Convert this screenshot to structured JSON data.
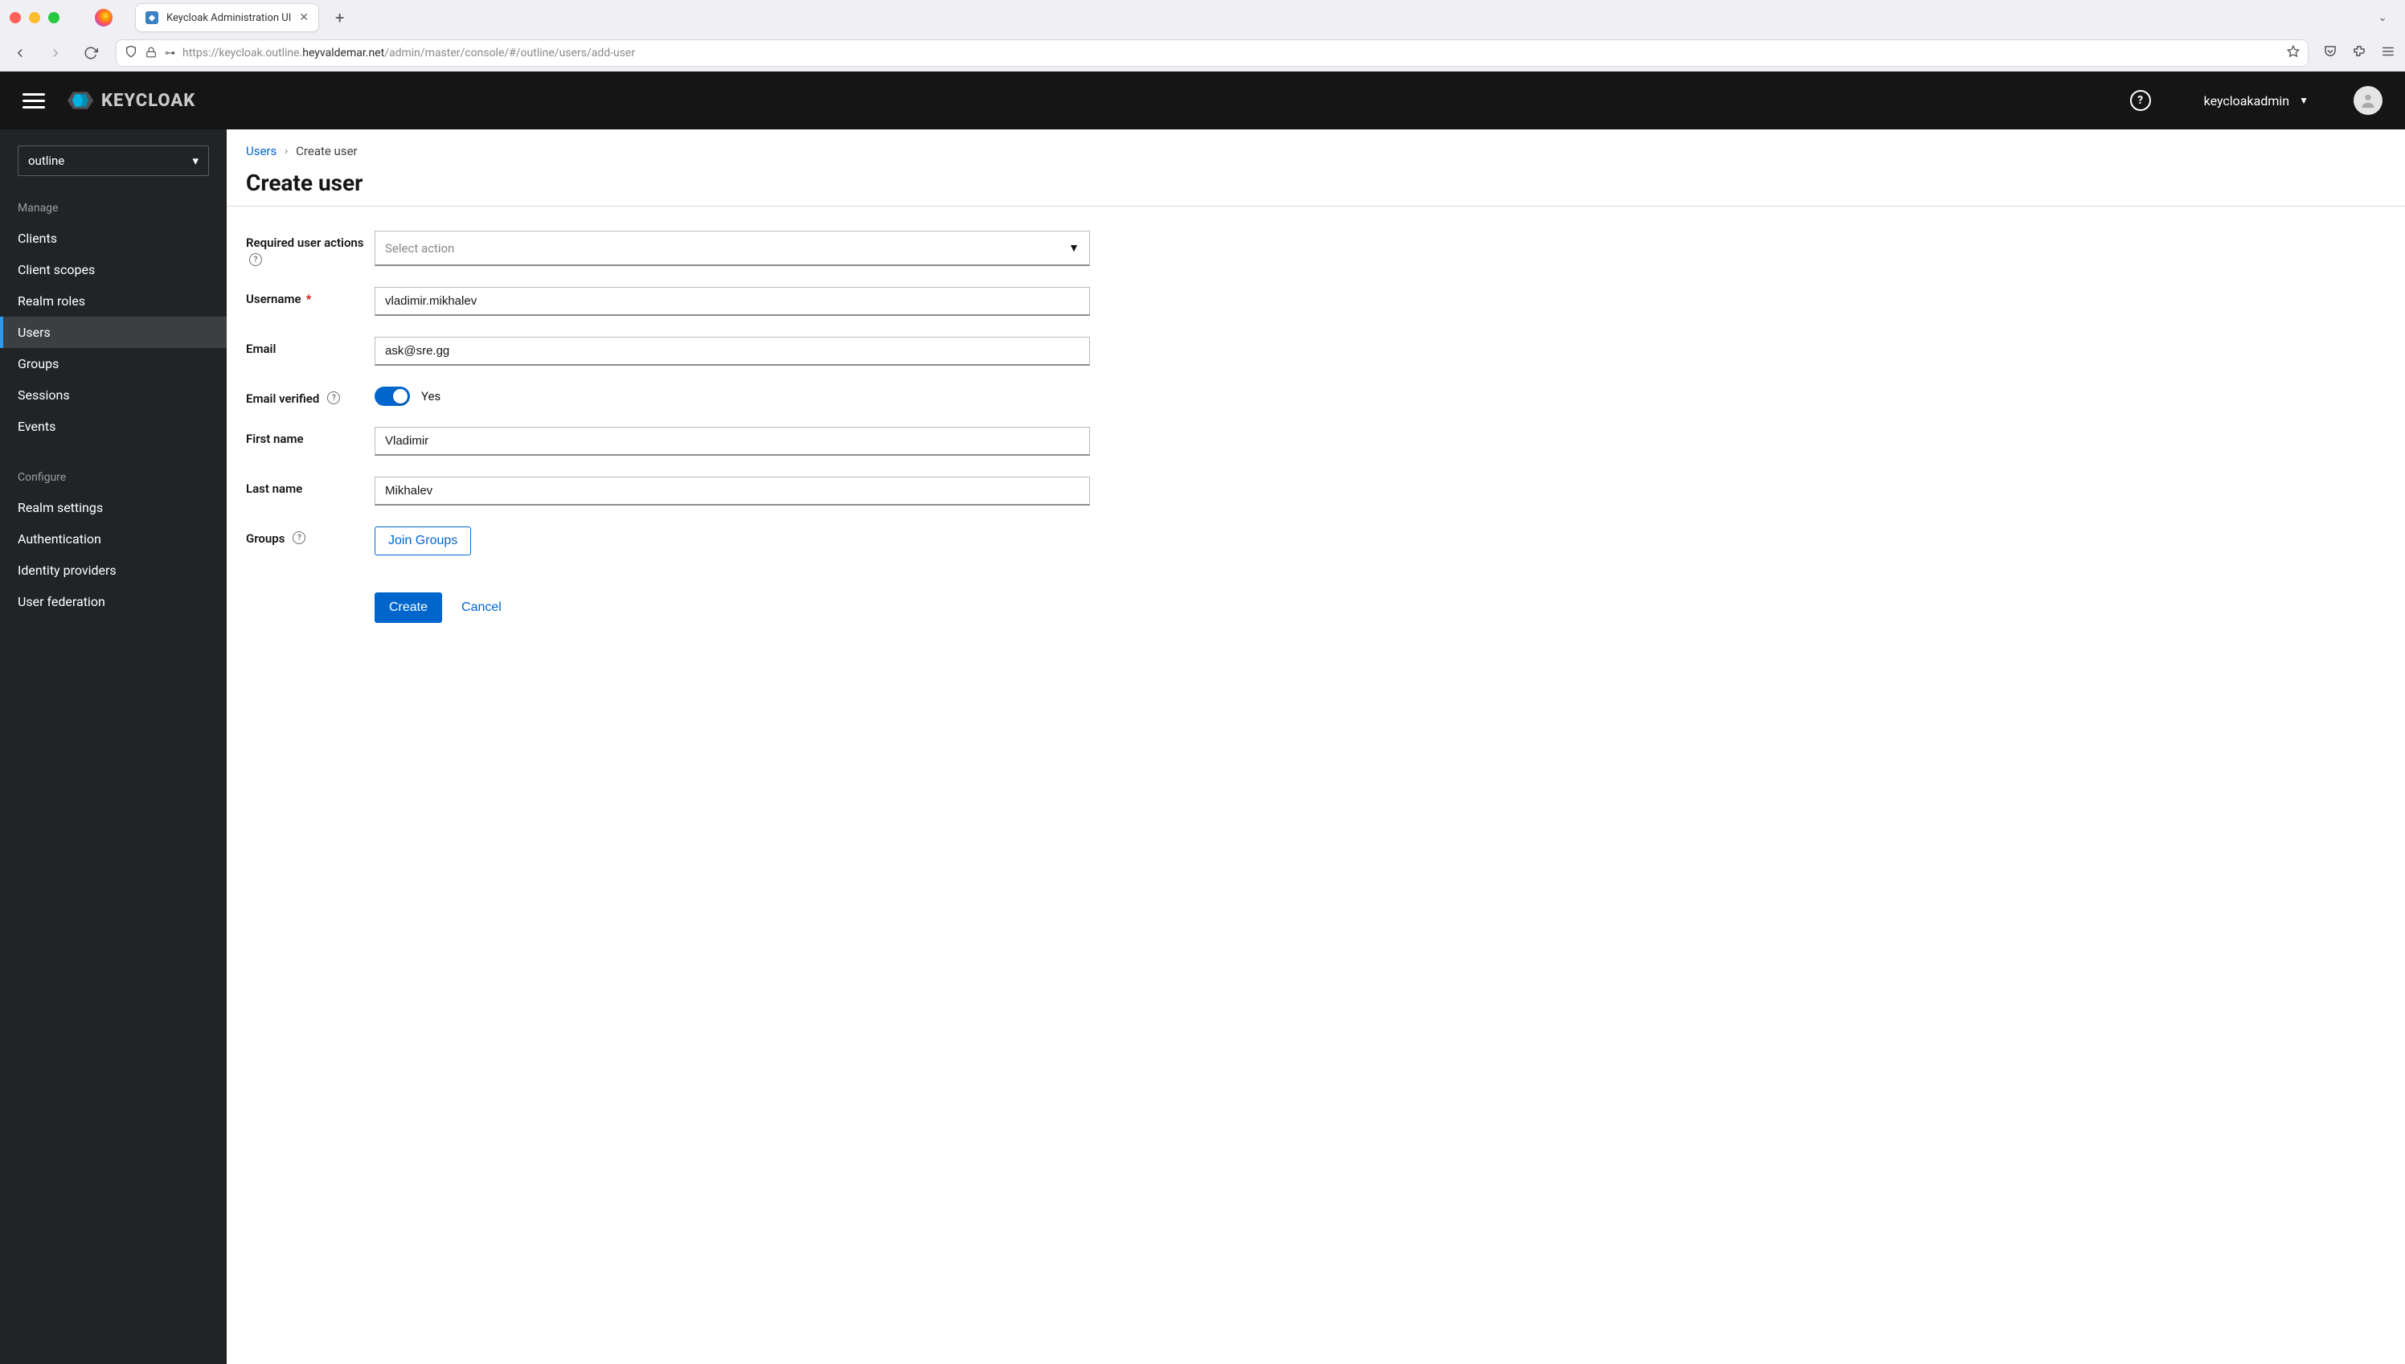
{
  "browser": {
    "tab_title": "Keycloak Administration UI",
    "url_prefix": "https://keycloak.outline.",
    "url_host": "heyvaldemar.net",
    "url_suffix": "/admin/master/console/#/outline/users/add-user"
  },
  "header": {
    "brand": "KEYCLOAK",
    "user": "keycloakadmin"
  },
  "sidebar": {
    "realm": "outline",
    "manage_label": "Manage",
    "configure_label": "Configure",
    "manage": [
      {
        "label": "Clients"
      },
      {
        "label": "Client scopes"
      },
      {
        "label": "Realm roles"
      },
      {
        "label": "Users"
      },
      {
        "label": "Groups"
      },
      {
        "label": "Sessions"
      },
      {
        "label": "Events"
      }
    ],
    "configure": [
      {
        "label": "Realm settings"
      },
      {
        "label": "Authentication"
      },
      {
        "label": "Identity providers"
      },
      {
        "label": "User federation"
      }
    ]
  },
  "breadcrumb": {
    "root": "Users",
    "current": "Create user"
  },
  "page": {
    "title": "Create user"
  },
  "form": {
    "required_actions": {
      "label": "Required user actions",
      "placeholder": "Select action"
    },
    "username": {
      "label": "Username",
      "value": "vladimir.mikhalev"
    },
    "email": {
      "label": "Email",
      "value": "ask@sre.gg"
    },
    "email_verified": {
      "label": "Email verified",
      "toggle_label": "Yes"
    },
    "first_name": {
      "label": "First name",
      "value": "Vladimir"
    },
    "last_name": {
      "label": "Last name",
      "value": "Mikhalev"
    },
    "groups": {
      "label": "Groups",
      "button": "Join Groups"
    },
    "buttons": {
      "create": "Create",
      "cancel": "Cancel"
    }
  }
}
